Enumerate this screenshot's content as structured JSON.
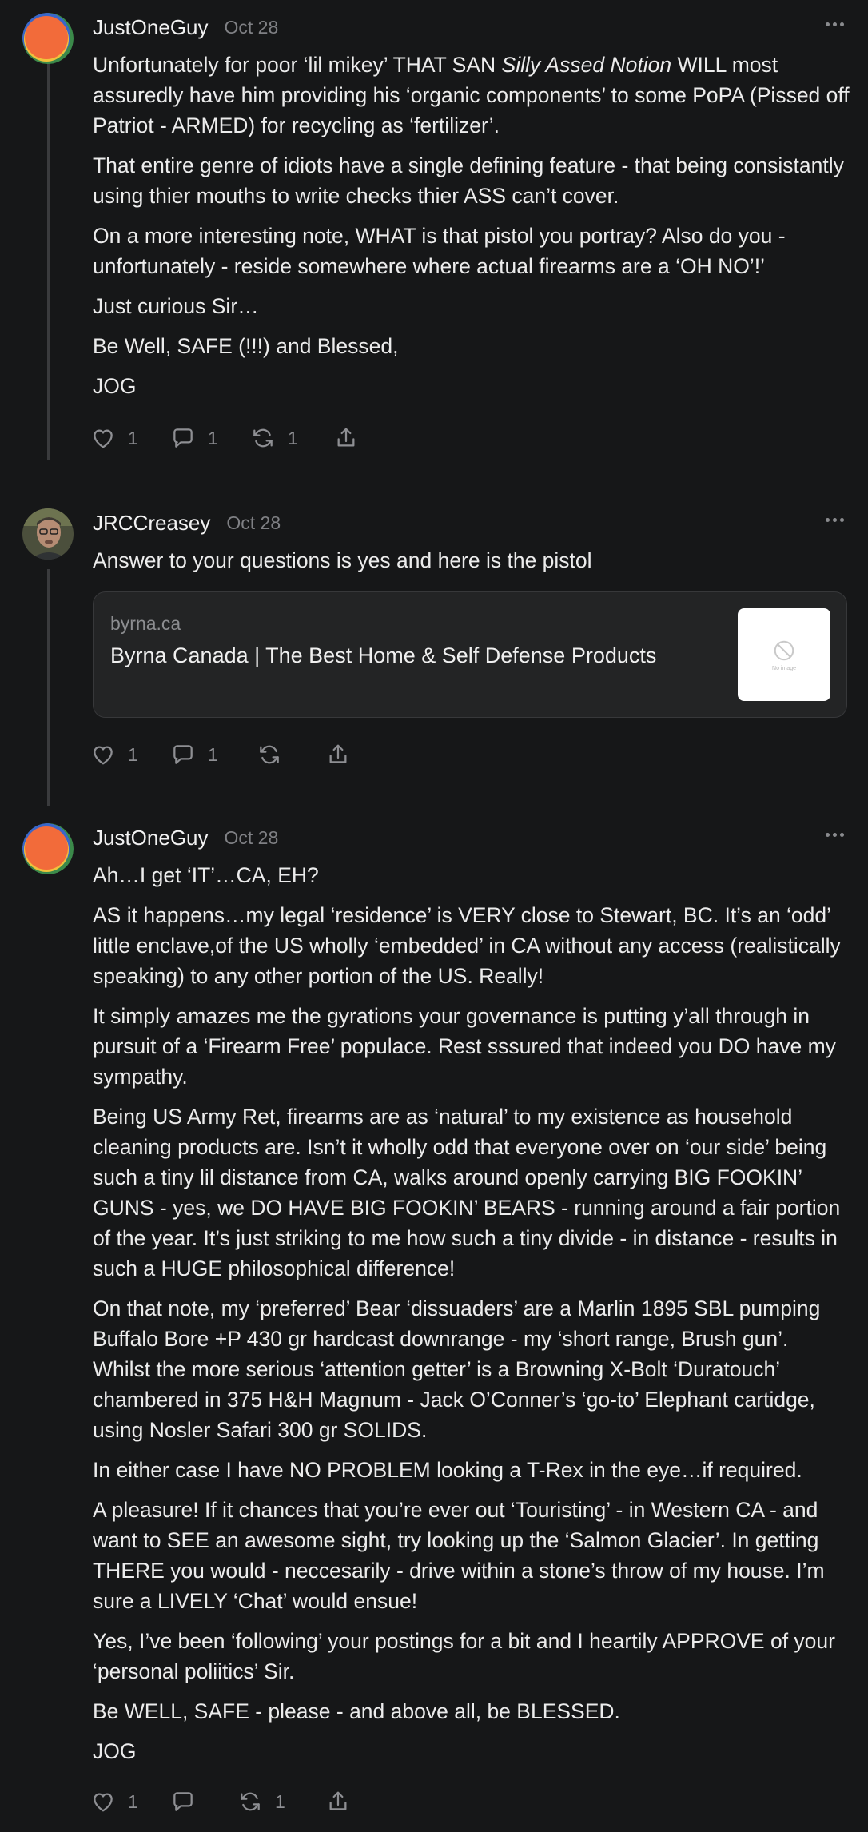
{
  "comments": [
    {
      "username": "JustOneGuy",
      "date": "Oct 28",
      "paragraphs": [
        {
          "before": "Unfortunately for poor ‘lil mikey’ THAT SAN ",
          "italic": "Silly Assed Notion",
          "after": " WILL most assuredly have him providing his ‘organic components’ to some PoPA (Pissed off Patriot - ARMED) for recycling as ‘fertilizer’."
        },
        {
          "text": "That entire genre of idiots have a single defining feature - that being consistantly using thier mouths to write checks thier ASS can’t cover."
        },
        {
          "text": "On a more interesting note, WHAT is that pistol you portray? Also do you - unfortunately - reside somewhere where actual firearms are a ‘OH NO’!’"
        },
        {
          "text": "Just curious Sir…"
        },
        {
          "text": "Be Well, SAFE (!!!) and Blessed,"
        },
        {
          "text": "JOG"
        }
      ],
      "actions": {
        "likes": "1",
        "replies": "1",
        "restacks": "1"
      }
    },
    {
      "username": "JRCCreasey",
      "date": "Oct 28",
      "paragraphs": [
        {
          "text": "Answer to your questions is yes and here is the pistol"
        }
      ],
      "link": {
        "domain": "byrna.ca",
        "title": "Byrna Canada | The Best Home & Self Defense Products",
        "thumb_text": "No image"
      },
      "actions": {
        "likes": "1",
        "replies": "1",
        "restacks": ""
      }
    },
    {
      "username": "JustOneGuy",
      "date": "Oct 28",
      "paragraphs": [
        {
          "text": "Ah…I get ‘IT’…CA, EH?"
        },
        {
          "text": "AS it happens…my legal ‘residence’ is VERY close to Stewart, BC. It’s an ‘odd’ little enclave,of the US wholly ‘embedded’ in CA without any access (realistically speaking) to any other portion of the US. Really!"
        },
        {
          "text": "It simply amazes me the gyrations your governance is putting y’all through in pursuit of a ‘Firearm Free’ populace. Rest sssured that indeed you DO have my sympathy."
        },
        {
          "text": "Being US Army Ret, firearms are as ‘natural’ to my existence as household cleaning products are. Isn’t it wholly odd that everyone over on ‘our side’ being such a tiny lil distance from CA, walks around openly carrying BIG FOOKIN’ GUNS - yes, we DO HAVE BIG FOOKIN’ BEARS - running around a fair portion of the year. It’s just striking to me how such a tiny divide - in distance - results in such a HUGE philosophical difference!"
        },
        {
          "text": "On that note, my ‘preferred’ Bear ‘dissuaders’ are a Marlin 1895 SBL pumping Buffalo Bore +P 430 gr hardcast downrange - my ‘short range, Brush gun’. Whilst the more serious ‘attention getter’ is a Browning X-Bolt ‘Duratouch’ chambered in 375 H&H Magnum - Jack O’Conner’s ‘go-to’ Elephant cartidge, using Nosler Safari 300 gr SOLIDS."
        },
        {
          "text": "In either case I have NO PROBLEM looking a T-Rex in the eye…if required."
        },
        {
          "text": "A pleasure! If it chances that you’re ever out ‘Touristing’ - in Western CA - and want to SEE an awesome sight, try looking up the ‘Salmon Glacier’. In getting THERE you would - neccesarily - drive within a stone’s throw of my house. I’m sure a LIVELY ‘Chat’ would ensue!"
        },
        {
          "text": "Yes, I’ve been ‘following’ your postings for a bit and I heartily APPROVE of your ‘personal poliitics’ Sir."
        },
        {
          "text": "Be WELL, SAFE - please - and above all, be BLESSED."
        },
        {
          "text": "JOG"
        }
      ],
      "actions": {
        "likes": "1",
        "replies": "",
        "restacks": "1"
      }
    }
  ],
  "icons": {
    "like": "heart-icon",
    "reply": "speech-bubble-icon",
    "restack": "restack-arrows-icon",
    "share": "share-upload-icon",
    "more": "more-dots-icon",
    "avatar1": "orange-circle-avatar",
    "avatar2": "profile-photo-avatar",
    "link_thumb": "no-image-icon"
  },
  "colors": {
    "background": "#161718",
    "text": "#ececec",
    "muted": "#8e8f93",
    "card": "#232425",
    "thread_line": "#3a3b3d",
    "avatar_orange": "#f26b3a"
  }
}
